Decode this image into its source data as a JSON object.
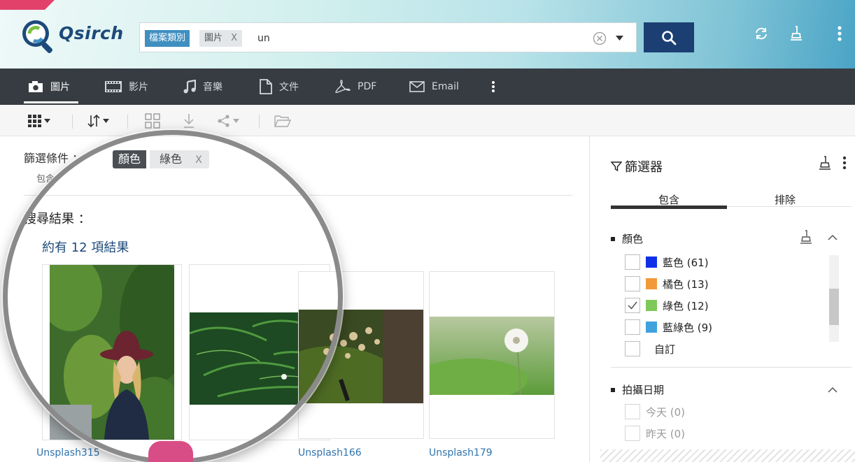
{
  "header": {
    "logo_text": "Qsirch",
    "search": {
      "type_chip": "檔案類別",
      "value_chip": "圖片",
      "value_chip_x": "X",
      "query": "un"
    }
  },
  "categories": [
    {
      "icon": "camera-icon",
      "label": "圖片"
    },
    {
      "icon": "film-icon",
      "label": "影片"
    },
    {
      "icon": "music-note-icon",
      "label": "音樂"
    },
    {
      "icon": "document-icon",
      "label": "文件"
    },
    {
      "icon": "pdf-icon",
      "label": "PDF"
    },
    {
      "icon": "envelope-icon",
      "label": "Email"
    }
  ],
  "main": {
    "filter_label": "篩選條件 ：",
    "filter_label_sub": "包含",
    "filter_chip_category": "顏色",
    "filter_chip_value": "綠色",
    "filter_chip_x": "X",
    "results_label": "搜尋結果 ：",
    "results_count": "約有 12 項結果",
    "results": [
      {
        "caption": "Unsplash315"
      },
      {
        "caption": ""
      },
      {
        "caption": "Unsplash166"
      },
      {
        "caption": "Unsplash179"
      }
    ]
  },
  "sidebar": {
    "title": "篩選器",
    "tabs": [
      "包含",
      "排除"
    ],
    "color_section": {
      "title": "顏色",
      "options": [
        {
          "label": "藍色 (61)",
          "color": "#1030e8",
          "checked": false
        },
        {
          "label": "橘色 (13)",
          "color": "#f29a3a",
          "checked": false
        },
        {
          "label": "綠色 (12)",
          "color": "#7dc95a",
          "checked": true
        },
        {
          "label": "藍綠色 (9)",
          "color": "#3fa2dc",
          "checked": false
        },
        {
          "label": "自訂",
          "color": null,
          "checked": false
        }
      ]
    },
    "date_section": {
      "title": "拍攝日期",
      "options": [
        {
          "label": "今天 (0)"
        },
        {
          "label": "昨天 (0)"
        }
      ]
    }
  },
  "colors": {
    "accent": "#1c3f73",
    "chip_blue": "#3f8fc0",
    "link": "#2f74ae",
    "brand_pink": "#e2426a"
  }
}
